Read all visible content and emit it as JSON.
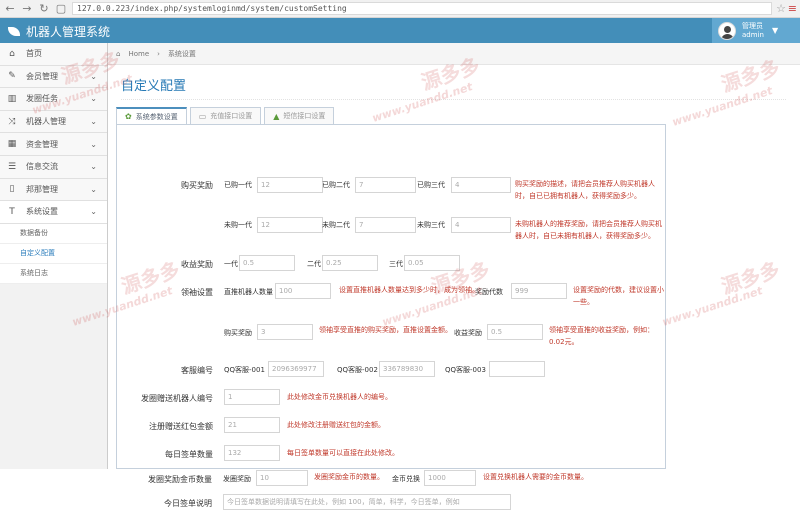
{
  "browser": {
    "url": "127.0.0.223/index.php/systemloginmd/system/customSetting"
  },
  "app": {
    "title": "机器人管理系统"
  },
  "user": {
    "greeting": "管理员",
    "name": "admin"
  },
  "sidebar": {
    "items": [
      {
        "label": "首页",
        "icon": "home-icon"
      },
      {
        "label": "会员管理",
        "icon": "edit-icon"
      },
      {
        "label": "发圈任务",
        "icon": "chart-icon"
      },
      {
        "label": "机器人管理",
        "icon": "shuffle-icon"
      },
      {
        "label": "资金管理",
        "icon": "calendar-icon"
      },
      {
        "label": "信息交流",
        "icon": "list-icon"
      },
      {
        "label": "邦那管理",
        "icon": "file-icon"
      },
      {
        "label": "系统设置",
        "icon": "text-icon"
      }
    ],
    "subitems": [
      {
        "label": "数据备份"
      },
      {
        "label": "自定义配置"
      },
      {
        "label": "系统日志"
      }
    ]
  },
  "breadcrumb": {
    "home": "Home",
    "current": "系统设置"
  },
  "page": {
    "title": "自定义配置"
  },
  "tabs": [
    {
      "label": "系统参数设置",
      "icon": "gear-icon"
    },
    {
      "label": "充值接口设置",
      "icon": "card-icon"
    },
    {
      "label": "短信接口设置",
      "icon": "user-icon"
    }
  ],
  "form": {
    "buy_reward": {
      "label": "购买奖励",
      "row1": {
        "gen1": "已购一代",
        "v1": "12",
        "gen2": "已购二代",
        "v2": "7",
        "gen3": "已购三代",
        "v3": "4",
        "help": "购买奖励的描述，请把会员推荐人购买机器人时，自已已拥有机器人，获得奖励多少。"
      },
      "row2": {
        "gen1": "未购一代",
        "v1": "12",
        "gen2": "未购二代",
        "v2": "7",
        "gen3": "未购三代",
        "v3": "4",
        "help": "未购机器人的推荐奖励，请把会员推荐人购买机器人时，自已未拥有机器人，获得奖励多少。"
      }
    },
    "income_reward": {
      "label": "收益奖励",
      "g1": "一代",
      "v1": "0.5",
      "g2": "二代",
      "v2": "0.25",
      "g3": "三代",
      "v3": "0.05"
    },
    "leader": {
      "label": "领袖设置",
      "direct_label": "直推机器人数量",
      "direct_value": "100",
      "direct_help": "设置直推机器人数量达到多少时，成为领袖。",
      "gen_label": "奖励代数",
      "gen_value": "999",
      "gen_help": "设置奖励的代数，建议设置小一些。",
      "buy_label": "购买奖励",
      "buy_value": "3",
      "buy_help": "领袖享受直推的购买奖励，直推设置金额。",
      "income_label": "收益奖励",
      "income_value": "0.5",
      "income_help": "领袖享受直推的收益奖励，例如：0.02元。"
    },
    "service": {
      "label": "客服编号",
      "q1": "QQ客服-001",
      "v1": "2096369977",
      "q2": "QQ客服-002",
      "v2": "336789830",
      "q3": "QQ客服-003",
      "v3": ""
    },
    "bot_no": {
      "label": "发圈赠送机器人编号",
      "value": "1",
      "help": "此处修改金币兑换机器人的编号。"
    },
    "register": {
      "label": "注册赠送红包金额",
      "value": "21",
      "help": "此处修改注册赠送红包的金额。"
    },
    "daily": {
      "label": "每日签单数量",
      "value": "132",
      "help": "每日签单数量可以直接在此处修改。"
    },
    "coin": {
      "label": "发圈奖励金币数量",
      "v1_label": "发圈奖励",
      "v1": "10",
      "v1_help": "发圈奖励金币的数量。",
      "v2_label": "金币兑换",
      "v2": "1000",
      "v2_help": "设置兑换机器人需要的金币数量。"
    },
    "notice": {
      "label": "今日签单说明",
      "placeholder": "今日签单数据说明请填写在此处，例如 100，简单，科学，今日签单，例如"
    }
  },
  "watermark": {
    "text": "源多多",
    "url": "www.yuandd.net"
  },
  "colors": {
    "header": "#438eb9",
    "usermenu": "#62a8d1",
    "title": "#2679b5",
    "help": "#c0392b"
  }
}
